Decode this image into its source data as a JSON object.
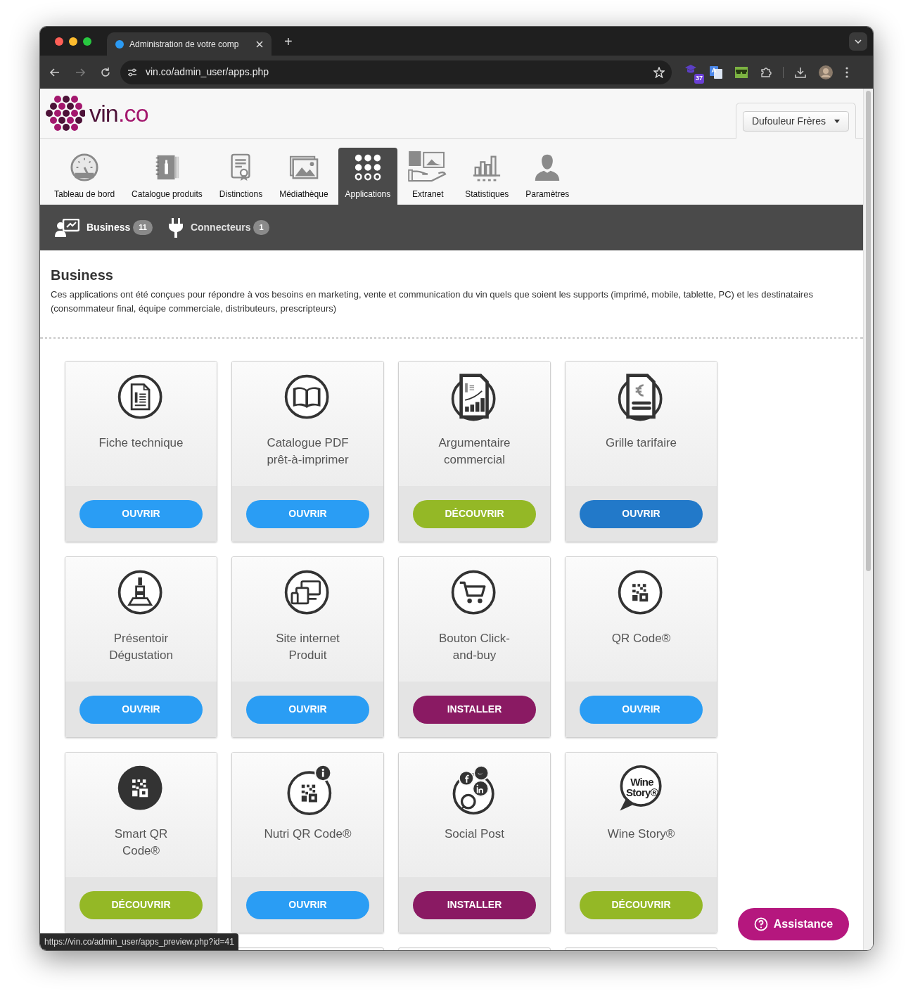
{
  "browser": {
    "tab": {
      "title": "Administration de votre comp",
      "selected": true
    },
    "new_tab": "+",
    "address": "vin.co/admin_user/apps.php",
    "extension_badge": "37"
  },
  "logo": {
    "name": "vin",
    "suffix": ".co"
  },
  "account_menu": "Dufouleur Frères",
  "nav": [
    {
      "label": "Tableau de bord",
      "selected": false
    },
    {
      "label": "Catalogue produits",
      "selected": false
    },
    {
      "label": "Distinctions",
      "selected": false
    },
    {
      "label": "Médiathèque",
      "selected": false
    },
    {
      "label": "Applications",
      "selected": true
    },
    {
      "label": "Extranet",
      "selected": false
    },
    {
      "label": "Statistiques",
      "selected": false
    },
    {
      "label": "Paramètres",
      "selected": false
    }
  ],
  "subnav": [
    {
      "label": "Business",
      "count": "11",
      "selected": true
    },
    {
      "label": "Connecteurs",
      "count": "1",
      "selected": false
    }
  ],
  "section": {
    "title": "Business",
    "description": "Ces applications ont été conçues pour répondre à vos besoins en marketing, vente et communication du vin quels que soient les supports (imprimé, mobile, tablette, PC) et les destinataires (consommateur final, équipe commerciale, distributeurs, prescripteurs)"
  },
  "cards": [
    {
      "kind": "app",
      "title": "Fiche technique",
      "button": {
        "label": "OUVRIR",
        "kind": "open",
        "hovered": false
      }
    },
    {
      "kind": "app",
      "title": "Catalogue PDF\nprêt-à-imprimer",
      "button": {
        "label": "OUVRIR",
        "kind": "open",
        "hovered": false
      }
    },
    {
      "kind": "app",
      "title": "Argumentaire\ncommercial",
      "button": {
        "label": "DÉCOUVRIR",
        "kind": "discover",
        "hovered": false
      }
    },
    {
      "kind": "app",
      "title": "Grille tarifaire",
      "button": {
        "label": "OUVRIR",
        "kind": "open",
        "hovered": true
      }
    },
    {
      "kind": "app",
      "title": "Présentoir\nDégustation",
      "button": {
        "label": "OUVRIR",
        "kind": "open",
        "hovered": false
      }
    },
    {
      "kind": "app",
      "title": "Site internet\nProduit",
      "button": {
        "label": "OUVRIR",
        "kind": "open",
        "hovered": false
      }
    },
    {
      "kind": "app",
      "title": "Bouton Click-\nand-buy",
      "button": {
        "label": "INSTALLER",
        "kind": "install",
        "hovered": false
      }
    },
    {
      "kind": "app",
      "title": "QR Code®",
      "button": {
        "label": "OUVRIR",
        "kind": "open",
        "hovered": false
      }
    },
    {
      "kind": "app",
      "title": "Smart QR\nCode®",
      "button": {
        "label": "DÉCOUVRIR",
        "kind": "discover",
        "hovered": false
      }
    },
    {
      "kind": "app",
      "title": "Nutri QR Code®",
      "button": {
        "label": "OUVRIR",
        "kind": "open",
        "hovered": false
      }
    },
    {
      "kind": "app",
      "title": "Social Post",
      "button": {
        "label": "INSTALLER",
        "kind": "install",
        "hovered": false
      }
    },
    {
      "kind": "app",
      "title": "Wine Story®",
      "logo_lines": [
        "Wine",
        "Story®"
      ],
      "button": {
        "label": "DÉCOUVRIR",
        "kind": "discover",
        "hovered": false
      }
    },
    {
      "kind": "cut_off"
    },
    {
      "kind": "cut_off"
    },
    {
      "kind": "cut_off"
    }
  ],
  "assistance_button": "Assistance",
  "status_url": "https://vin.co/admin_user/apps_preview.php?id=41"
}
